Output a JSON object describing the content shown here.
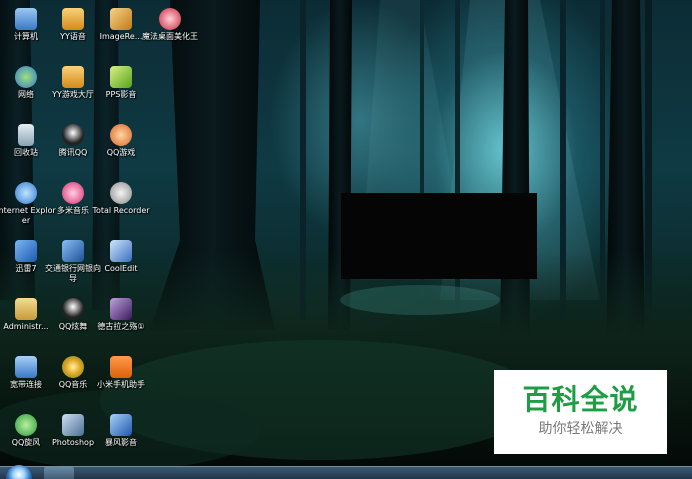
{
  "desktop": {
    "icons": [
      {
        "label": "计算机",
        "icon": "computer-icon",
        "color": "#6ea8e8"
      },
      {
        "label": "YY语音",
        "icon": "yy-voice-icon",
        "color": "#f2b233"
      },
      {
        "label": "ImageRe...",
        "icon": "image-app-icon",
        "color": "#e0a030"
      },
      {
        "label": "魔法桌面美化王",
        "icon": "magic-desktop-icon",
        "color": "#d9334a"
      },
      {
        "label": "网络",
        "icon": "network-icon",
        "color": "#4a90d9"
      },
      {
        "label": "YY游戏大厅",
        "icon": "yy-game-hall-icon",
        "color": "#f2b233"
      },
      {
        "label": "PPS影音",
        "icon": "pps-player-icon",
        "color": "#8cc63f"
      },
      {
        "label": "回收站",
        "icon": "recycle-bin-icon",
        "color": "#b9c9d6"
      },
      {
        "label": "腾讯QQ",
        "icon": "qq-penguin-icon",
        "color": "#f2c12e"
      },
      {
        "label": "QQ游戏",
        "icon": "qq-game-icon",
        "color": "#e6803a"
      },
      {
        "label": "Internet Explorer",
        "icon": "internet-explorer-icon",
        "color": "#3c8be0"
      },
      {
        "label": "多米音乐",
        "icon": "duomi-music-icon",
        "color": "#e94b86"
      },
      {
        "label": "Total Recorder",
        "icon": "total-recorder-icon",
        "color": "#d6d6d6"
      },
      {
        "label": "迅雷7",
        "icon": "thunder-icon",
        "color": "#3a7ad8"
      },
      {
        "label": "交通银行网银向导",
        "icon": "bank-guide-icon",
        "color": "#2c6bc4"
      },
      {
        "label": "CoolEdit",
        "icon": "cooledit-icon",
        "color": "#6aa6e8"
      },
      {
        "label": "Administr...",
        "icon": "user-folder-icon",
        "color": "#e6c36a"
      },
      {
        "label": "QQ炫舞",
        "icon": "qq-dance-icon",
        "color": "#f2c12e"
      },
      {
        "label": "德古拉之殇①",
        "icon": "dracula-game-icon",
        "color": "#7a4aa8"
      },
      {
        "label": "宽带连接",
        "icon": "broadband-connection-icon",
        "color": "#4a90d9"
      },
      {
        "label": "QQ音乐",
        "icon": "qq-music-icon",
        "color": "#f2c12e"
      },
      {
        "label": "小米手机助手",
        "icon": "xiaomi-assistant-icon",
        "color": "#f27a1a"
      },
      {
        "label": "QQ旋风",
        "icon": "qq-whirlwind-icon",
        "color": "#3cb44a"
      },
      {
        "label": "Photoshop",
        "icon": "photoshop-icon",
        "color": "#6a8fb8"
      },
      {
        "label": "暴风影音",
        "icon": "baofeng-player-icon",
        "color": "#3a7ad8"
      }
    ]
  },
  "watermark": {
    "title": "百科全说",
    "subtitle": "助你轻松解决"
  },
  "taskbar": {
    "start_icon": "windows-orb-icon",
    "pinned_icon": "internet-explorer-icon"
  }
}
